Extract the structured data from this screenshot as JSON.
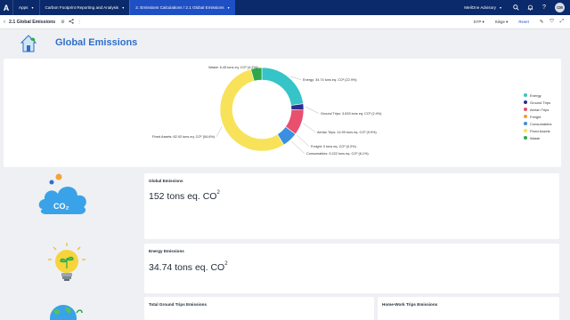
{
  "topbar": {
    "logo": "A",
    "tabs": [
      {
        "label": "Apps"
      },
      {
        "label": "Carbon Footprint Reporting and Analysis"
      },
      {
        "label": "2. Emissions Calculations / 2.1 Global Emissions"
      }
    ],
    "org": "MeilOne Advisory",
    "avatar": "CM"
  },
  "toolbar": {
    "page_title": "2.1 Global Emissions",
    "period": "SYP",
    "site": "Siège",
    "reset": "Reset"
  },
  "header": {
    "title": "Global Emissions"
  },
  "chart_data": {
    "type": "pie",
    "donut": true,
    "slices": [
      {
        "name": "Energy",
        "value": 34.74,
        "pct": 22.9,
        "color": "#35c4c7",
        "label": "Energy: 34.74 tons eq. CO² (22.9%)"
      },
      {
        "name": "Ground Trips",
        "value": 3.633,
        "pct": 2.4,
        "color": "#2d2d8f",
        "label": "Ground Trips: 3.633 tons eq. CO² (2.4%)"
      },
      {
        "name": "Aerian Trips",
        "value": 14.99,
        "pct": 9.9,
        "color": "#e8506e",
        "label": "Aerian Trips: 14.99 tons eq. CO² (9.9%)"
      },
      {
        "name": "Freight",
        "value": 0,
        "pct": 0.0,
        "color": "#f29b3a",
        "label": "Freight: 0 tons eq. CO² (0.0%)"
      },
      {
        "name": "Consumables",
        "value": 9.222,
        "pct": 6.1,
        "color": "#3a8fe0",
        "label": "Consumables: 9.222 tons eq. CO² (6.1%)"
      },
      {
        "name": "Fixed Assets",
        "value": 82.92,
        "pct": 54.6,
        "color": "#f7e25a",
        "label": "Fixed Assets: 82.92 tons eq. CO² (54.6%)"
      },
      {
        "name": "Waste",
        "value": 6.45,
        "pct": 4.2,
        "color": "#2ea84a",
        "label": "Waste: 6.45 tons eq. CO² (4.2%)"
      }
    ],
    "legend_position": "right"
  },
  "cards": {
    "global": {
      "label": "Global Emissions",
      "value": "152 tons eq. CO",
      "unit_sup": "2"
    },
    "energy": {
      "label": "Energy Emissions",
      "value": "34.74 tons eq. CO",
      "unit_sup": "2"
    },
    "ground": {
      "label": "Total Ground Trips Emissions"
    },
    "homework": {
      "label": "Home-Work Trips Emissions"
    }
  },
  "illustrations": {
    "cloud_text": "CO₂"
  },
  "colors": {
    "nav_bg": "#0b2a6b",
    "nav_active": "#1e4fc4",
    "title_blue": "#2f6fc9"
  }
}
